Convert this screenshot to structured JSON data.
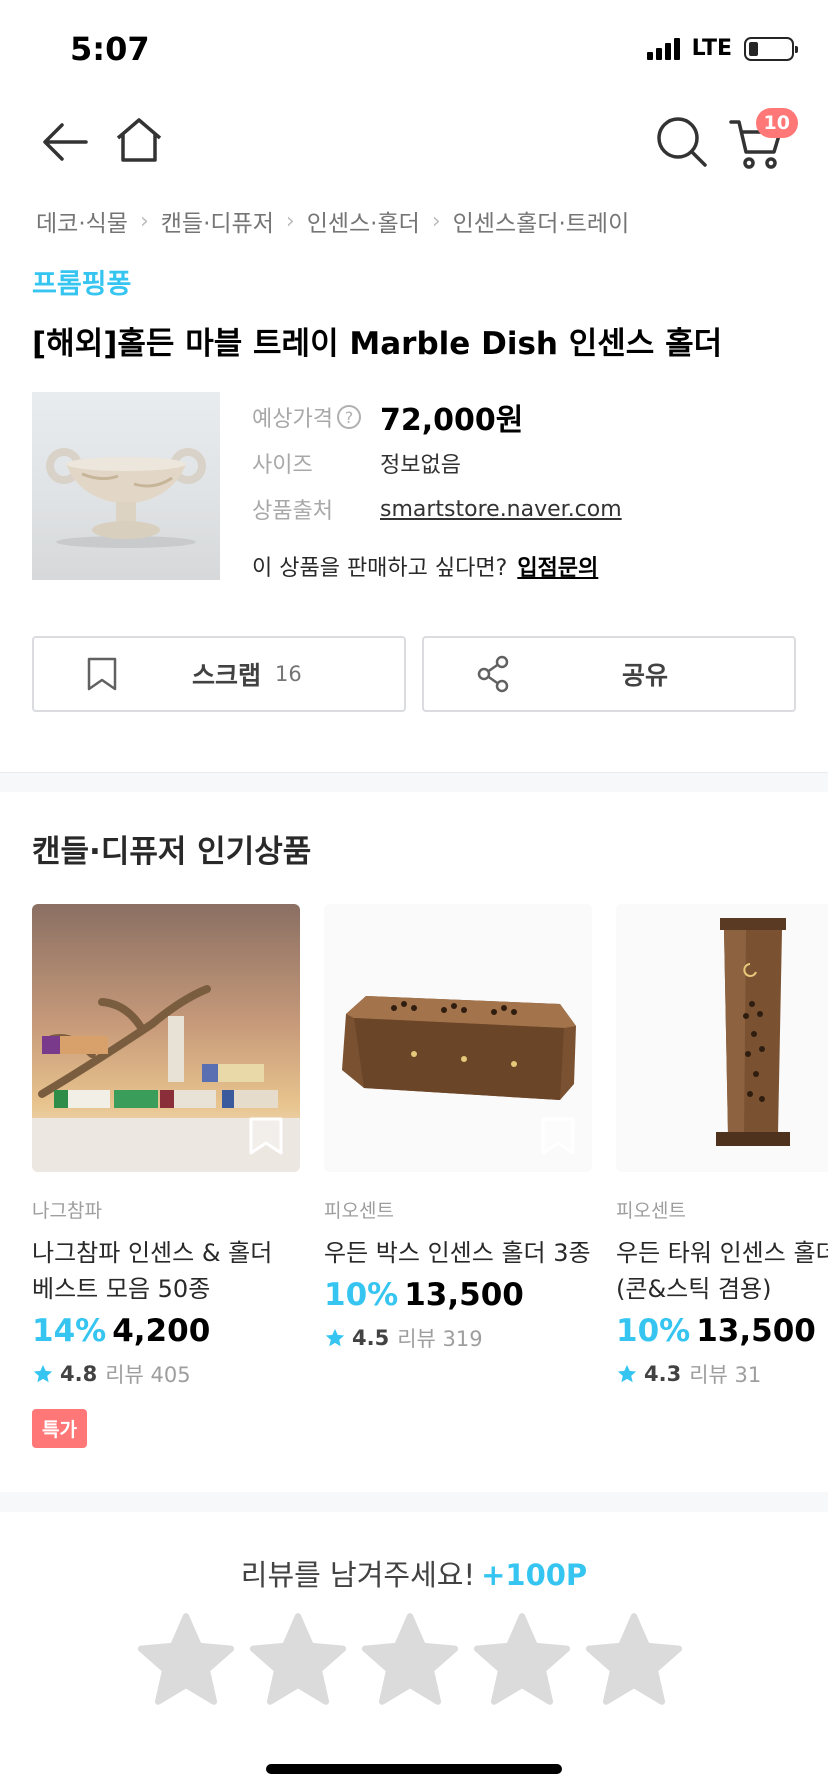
{
  "status_bar": {
    "time": "5:07",
    "network": "LTE"
  },
  "nav": {
    "cart_count": "10"
  },
  "breadcrumb": [
    "데코·식물",
    "캔들·디퓨저",
    "인센스·홀더",
    "인센스홀더·트레이"
  ],
  "product": {
    "brand": "프롬핑퐁",
    "title": "[해외]홀든 마블 트레이 Marble Dish 인센스 홀더",
    "price_label": "예상가격",
    "price": "72,000원",
    "size_label": "사이즈",
    "size": "정보없음",
    "source_label": "상품출처",
    "source": "smartstore.naver.com",
    "sell_text": "이 상품을 판매하고 싶다면?",
    "sell_link": "입점문의"
  },
  "actions": {
    "scrap_label": "스크랩",
    "scrap_count": "16",
    "share_label": "공유"
  },
  "popular": {
    "title": "캔들·디퓨저 인기상품",
    "items": [
      {
        "brand": "나그참파",
        "name_line1": "나그참파 인센스 & 홀더",
        "name_line2": "베스트 모음 50종",
        "discount": "14%",
        "price": "4,200",
        "rating": "4.8",
        "reviews": "리뷰 405",
        "tag": "특가"
      },
      {
        "brand": "피오센트",
        "name_line1": "우든 박스 인센스 홀더 3종",
        "name_line2": "",
        "discount": "10%",
        "price": "13,500",
        "rating": "4.5",
        "reviews": "리뷰 319"
      },
      {
        "brand": "피오센트",
        "name_line1": "우든 타워 인센스 홀더",
        "name_line2": "(콘&스틱 겸용)",
        "discount": "10%",
        "price": "13,500",
        "rating": "4.3",
        "reviews": "리뷰 31"
      }
    ]
  },
  "review": {
    "prompt": "리뷰를 남겨주세요!",
    "points": "+100P",
    "star_count": 5
  },
  "colors": {
    "accent": "#35c5f0",
    "badge": "#ff7777",
    "star_gray": "#dbdbdb"
  },
  "icons": [
    "back-arrow-icon",
    "home-icon",
    "search-icon",
    "cart-icon",
    "bookmark-icon",
    "share-icon",
    "star-icon"
  ]
}
